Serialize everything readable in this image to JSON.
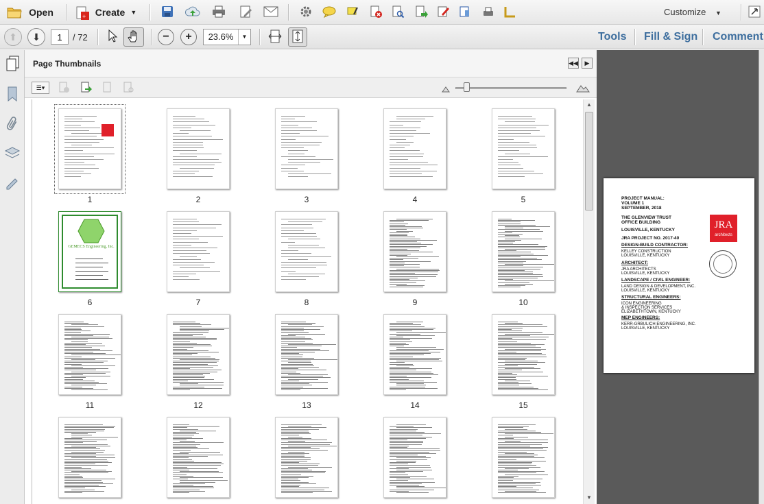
{
  "toolbar": {
    "open_label": "Open",
    "create_label": "Create",
    "customize_label": "Customize"
  },
  "nav": {
    "page_current": "1",
    "page_total": "/ 72",
    "zoom": "23.6%",
    "tools_label": "Tools",
    "fill_sign_label": "Fill & Sign",
    "comment_label": "Comment"
  },
  "panel": {
    "title": "Page Thumbnails"
  },
  "thumbnails": [
    {
      "n": "1"
    },
    {
      "n": "2"
    },
    {
      "n": "3"
    },
    {
      "n": "4"
    },
    {
      "n": "5"
    },
    {
      "n": "6"
    },
    {
      "n": "7"
    },
    {
      "n": "8"
    },
    {
      "n": "9"
    },
    {
      "n": "10"
    },
    {
      "n": "11"
    },
    {
      "n": "12"
    },
    {
      "n": "13"
    },
    {
      "n": "14"
    },
    {
      "n": "15"
    },
    {
      "n": ""
    },
    {
      "n": ""
    },
    {
      "n": ""
    },
    {
      "n": ""
    },
    {
      "n": ""
    }
  ],
  "thumb6": {
    "company": "GEMECS Engineering, Inc."
  },
  "preview": {
    "l1": "PROJECT MANUAL:",
    "l2": "VOLUME 1",
    "l3": "SEPTEMBER, 2018",
    "l4": "THE GLENVIEW TRUST",
    "l5": "OFFICE BUILDING",
    "l6": "LOUISVILLE, KENTUCKY",
    "l7": "JRA PROJECT NO. 2017-40",
    "h1": "DESIGN-BUILD CONTRACTOR:",
    "h1a": "KELLEY CONSTRUCTION",
    "h1b": "LOUISVILLE, KENTUCKY",
    "h2": "ARCHITECT:",
    "h2a": "JRA ARCHITECTS",
    "h2b": "LOUISVILLE, KENTUCKY",
    "h3": "LANDSCAPE / CIVIL ENGINEER:",
    "h3a": "LAND DESIGN & DEVELOPMENT, INC.",
    "h3b": "LOUISVILLE, KENTUCKY",
    "h4": "STRUCTURAL ENGINEERS:",
    "h4a": "ICON ENGINEERING",
    "h4b": "& INSPECTION SERVICES",
    "h4c": "ELIZABETHTOWN, KENTUCKY",
    "h5": "MEP ENGINEERS:",
    "h5a": "KERR-GRBULICH ENGINEERING, INC.",
    "h5b": "LOUISVILLE, KENTUCKY",
    "logo_text": "JRA",
    "logo_sub": "architects"
  },
  "colors": {
    "accent": "#3d6e9e",
    "logo_red": "#e0202a",
    "dark_panel": "#5a5a5a"
  }
}
